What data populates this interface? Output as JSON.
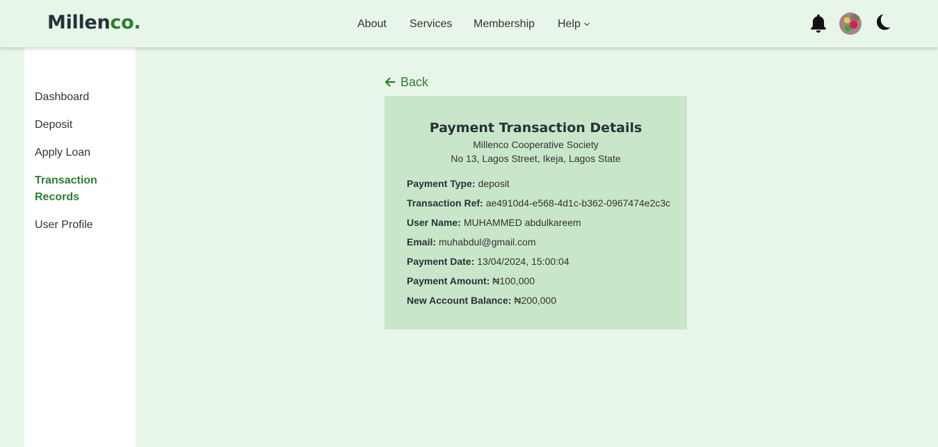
{
  "header": {
    "logo_main": "Millen",
    "logo_accent": "co.",
    "nav": [
      "About",
      "Services",
      "Membership",
      "Help"
    ]
  },
  "sidebar": {
    "items": [
      {
        "label": "Dashboard"
      },
      {
        "label": "Deposit"
      },
      {
        "label": "Apply Loan"
      },
      {
        "label": "Transaction Records",
        "active": true
      },
      {
        "label": "User Profile"
      }
    ]
  },
  "back_label": "Back",
  "details": {
    "title": "Payment Transaction Details",
    "org_name": "Millenco Cooperative Society",
    "org_address": "No 13, Lagos Street, Ikeja, Lagos State",
    "fields": [
      {
        "label": "Payment Type:",
        "value": "deposit"
      },
      {
        "label": "Transaction Ref:",
        "value": "ae4910d4-e568-4d1c-b362-0967474e2c3c"
      },
      {
        "label": "User Name:",
        "value": "MUHAMMED abdulkareem"
      },
      {
        "label": "Email:",
        "value": "muhabdul@gmail.com"
      },
      {
        "label": "Payment Date:",
        "value": "13/04/2024, 15:00:04"
      },
      {
        "label": "Payment Amount:",
        "value": "₦100,000"
      },
      {
        "label": "New Account Balance:",
        "value": "₦200,000"
      }
    ]
  },
  "icons": {
    "bell": "bell-icon",
    "moon": "moon-icon",
    "back": "arrow-left-icon",
    "chevron": "chevron-down-icon"
  },
  "colors": {
    "accent": "#2e7d32",
    "background": "#e8f5e9",
    "card": "#c8e6c9",
    "sidebar": "#ffffff"
  }
}
